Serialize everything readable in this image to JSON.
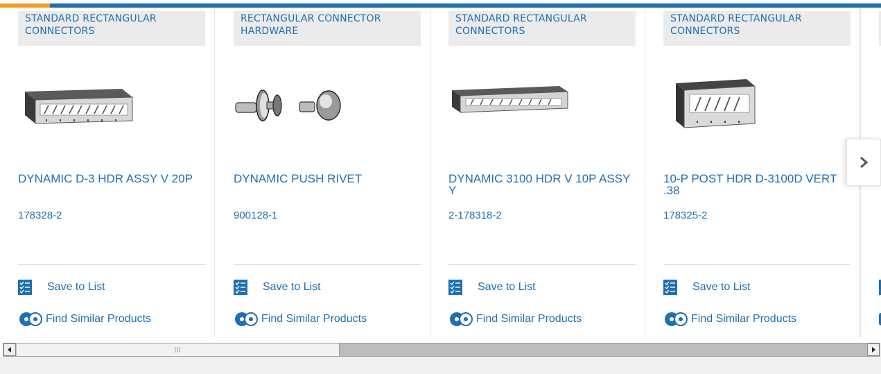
{
  "colors": {
    "brand_blue": "#1f6fb2",
    "accent_orange": "#f39c2a",
    "category_bg": "#ebebeb"
  },
  "cards": [
    {
      "category": "STANDARD RECTANGULAR CONNECTORS",
      "name": "DYNAMIC D-3 HDR ASSY V 20P",
      "part_number": "178328-2",
      "image": "connector-header-20p"
    },
    {
      "category": "RECTANGULAR CONNECTOR HARDWARE",
      "name": "DYNAMIC PUSH RIVET",
      "part_number": "900128-1",
      "image": "push-rivet"
    },
    {
      "category": "STANDARD RECTANGULAR CONNECTORS",
      "name": "DYNAMIC 3100 HDR V 10P ASSY Y",
      "part_number": "2-178318-2",
      "image": "connector-header-10p"
    },
    {
      "category": "STANDARD RECTANGULAR CONNECTORS",
      "name": "10-P POST HDR D-3100D VERT .38",
      "part_number": "178325-2",
      "image": "connector-post-header"
    }
  ],
  "actions": {
    "save_label": "Save to List",
    "find_label": "Find Similar Products"
  },
  "icons": {
    "save": "checklist-icon",
    "find": "similar-products-icon",
    "next": "chevron-right-icon"
  }
}
